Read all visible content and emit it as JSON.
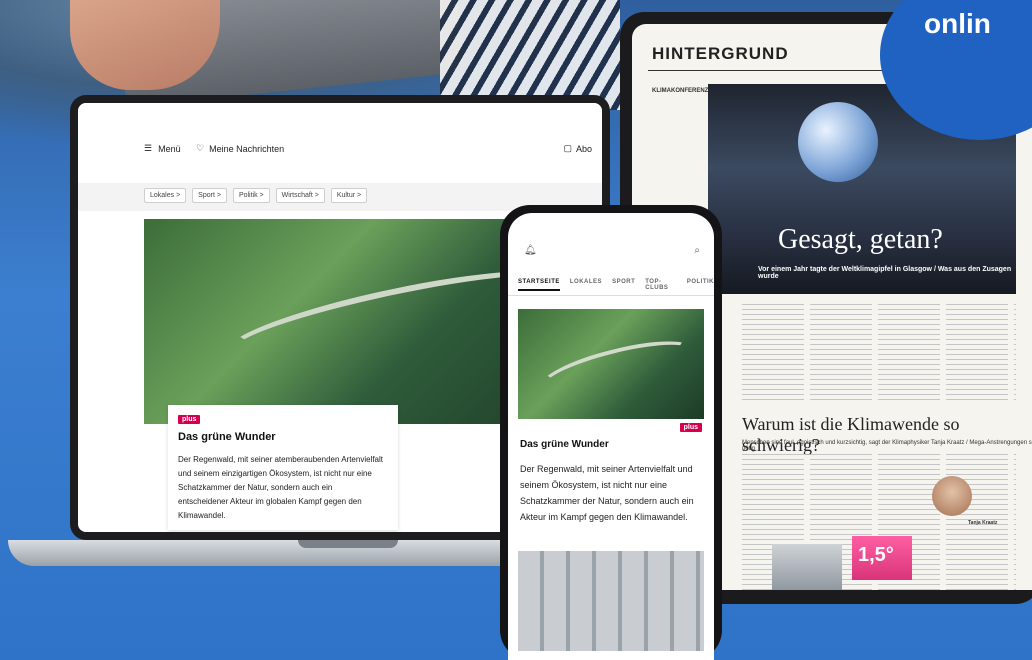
{
  "badge": {
    "text": "onlin"
  },
  "laptop": {
    "nav": {
      "menu_label": "Menü",
      "favorites_label": "Meine Nachrichten",
      "abo_label": "Abo"
    },
    "chips": [
      "Lokales >",
      "Sport >",
      "Politik >",
      "Wirtschaft >",
      "Kultur >"
    ],
    "article": {
      "badge": "plus",
      "title": "Das grüne Wunder",
      "text": "Der Regenwald, mit seiner atemberaubenden Artenvielfalt und seinem einzigartigen Ökosystem, ist nicht nur eine Schatzkammer der Natur, sondern auch ein entscheidener Akteur im globalen Kampf gegen den Klimawandel."
    }
  },
  "phone": {
    "tabs": [
      "STARTSEITE",
      "LOKALES",
      "SPORT",
      "TOP-CLUBS",
      "POLITIK"
    ],
    "article": {
      "badge": "plus",
      "title": "Das grüne Wunder",
      "text": "Der Regenwald, mit seiner Artenvielfalt und seinem Ökosystem, ist nicht nur eine Schatzkammer der Natur, sondern auch ein Akteur im Kampf gegen den Klimawandel."
    }
  },
  "newspaper": {
    "section": "HINTERGRUND",
    "side_title": "KLIMAKONFERENZ",
    "photo_title": "Gesagt, getan?",
    "photo_sub": "Vor einem Jahr tagte der Weltklimagipfel in Glasgow / Was aus den Zusagen wurde",
    "headline": "Warum ist die Klimawende so schwierig?",
    "headline_sub": "Menschen sind faul, egoistisch und kurzsichtig, sagt der Klimaphysiker Tanja Kraatz / Mega-Anstrengungen sind nötig",
    "chart_label": "1,5°",
    "quote_name": "Tanja Kraatz"
  }
}
